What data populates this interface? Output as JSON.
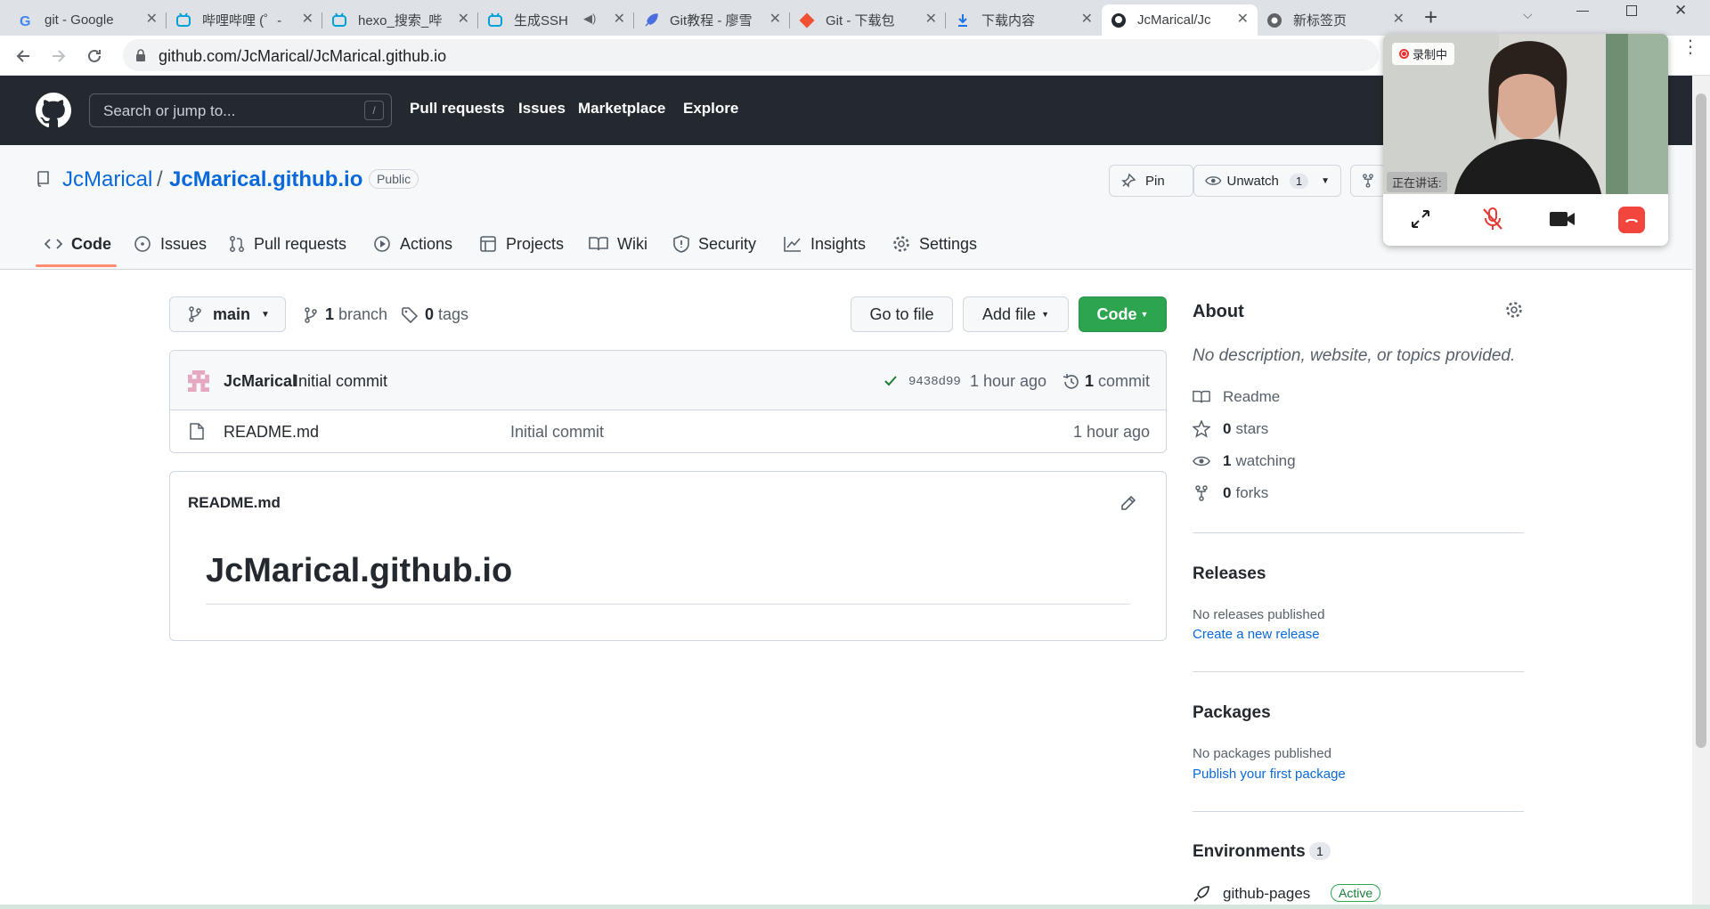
{
  "browser": {
    "tabs": [
      {
        "label": "git - Google",
        "icon": "google-icon"
      },
      {
        "label": "哔哩哔哩 (゜-",
        "icon": "bilibili-icon"
      },
      {
        "label": "hexo_搜索_哔",
        "icon": "bilibili-icon"
      },
      {
        "label": "生成SSH",
        "icon": "bilibili-icon"
      },
      {
        "label": "Git教程 - 廖雪",
        "icon": "rocket-icon"
      },
      {
        "label": "Git - 下载包",
        "icon": "git-icon"
      },
      {
        "label": "下载内容",
        "icon": "download-icon"
      },
      {
        "label": "JcMarical/Jc",
        "icon": "github-icon"
      },
      {
        "label": "新标签页",
        "icon": "chrome-icon"
      }
    ],
    "url": "github.com/JcMarical/JcMarical.github.io"
  },
  "header": {
    "search_placeholder": "Search or jump to...",
    "slash": "/",
    "nav": [
      "Pull requests",
      "Issues",
      "Marketplace",
      "Explore"
    ]
  },
  "repo": {
    "owner": "JcMarical",
    "separator": "/",
    "name": "JcMarical.github.io",
    "visibility": "Public",
    "pin_label": "Pin",
    "unwatch_label": "Unwatch",
    "watch_count": "1",
    "tabs": [
      "Code",
      "Issues",
      "Pull requests",
      "Actions",
      "Projects",
      "Wiki",
      "Security",
      "Insights",
      "Settings"
    ]
  },
  "files": {
    "branch": "main",
    "branch_count": "1",
    "branch_word": "branch",
    "tag_count": "0",
    "tag_word": "tags",
    "goto_file": "Go to file",
    "add_file": "Add file",
    "code": "Code",
    "commit": {
      "author": "JcMarical",
      "message": "Initial commit",
      "sha": "9438d99",
      "time": "1 hour ago",
      "count": "1",
      "count_word": "commit"
    },
    "rows": [
      {
        "name": "README.md",
        "message": "Initial commit",
        "time": "1 hour ago"
      }
    ]
  },
  "readme": {
    "filename": "README.md",
    "heading": "JcMarical.github.io"
  },
  "about": {
    "title": "About",
    "description": "No description, website, or topics provided.",
    "readme": "Readme",
    "stars_count": "0",
    "stars_word": "stars",
    "watching_count": "1",
    "watching_word": "watching",
    "forks_count": "0",
    "forks_word": "forks"
  },
  "releases": {
    "title": "Releases",
    "status": "No releases published",
    "link": "Create a new release"
  },
  "packages": {
    "title": "Packages",
    "status": "No packages published",
    "link": "Publish your first package"
  },
  "environments": {
    "title": "Environments",
    "count": "1",
    "item": "github-pages",
    "badge": "Active"
  },
  "video_call": {
    "recording_label": "录制中",
    "speaking_label": "正在讲话:"
  },
  "colors": {
    "accent_link": "#0969da",
    "header_bg": "#24292f",
    "primary_green": "#2da44e",
    "active_tab_underline": "#fd8c73"
  }
}
